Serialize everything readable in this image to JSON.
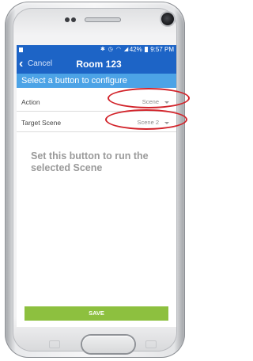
{
  "status_bar": {
    "signal_text": "42%",
    "time": "9:57 PM"
  },
  "nav": {
    "back_label": "Cancel",
    "title": "Room 123"
  },
  "section_header": "Select a button to configure",
  "fields": {
    "action": {
      "label": "Action",
      "value": "Scene"
    },
    "target_scene": {
      "label": "Target Scene",
      "value": "Scene 2"
    }
  },
  "info_text": "Set this button to run the selected Scene",
  "save_label": "SAVE",
  "colors": {
    "nav_blue": "#1d64c6",
    "header_blue": "#4ca3e6",
    "save_green": "#8dc03f",
    "highlight_red": "#d2232a"
  }
}
